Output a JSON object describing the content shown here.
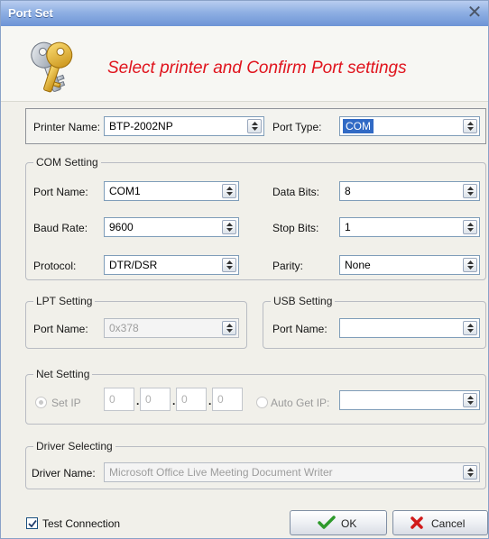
{
  "window": {
    "title": "Port Set"
  },
  "header": {
    "message": "Select printer and Confirm Port settings"
  },
  "printer": {
    "name_label": "Printer Name:",
    "name_value": "BTP-2002NP",
    "port_type_label": "Port Type:",
    "port_type_value": "COM"
  },
  "com": {
    "legend": "COM Setting",
    "port_name_label": "Port Name:",
    "port_name_value": "COM1",
    "baud_rate_label": "Baud Rate:",
    "baud_rate_value": "9600",
    "protocol_label": "Protocol:",
    "protocol_value": "DTR/DSR",
    "data_bits_label": "Data Bits:",
    "data_bits_value": "8",
    "stop_bits_label": "Stop Bits:",
    "stop_bits_value": "1",
    "parity_label": "Parity:",
    "parity_value": "None"
  },
  "lpt": {
    "legend": "LPT Setting",
    "port_name_label": "Port Name:",
    "port_name_value": "0x378"
  },
  "usb": {
    "legend": "USB Setting",
    "port_name_label": "Port Name:",
    "port_name_value": ""
  },
  "net": {
    "legend": "Net Setting",
    "set_ip_label": "Set IP",
    "ip_octets": [
      "0",
      "0",
      "0",
      "0"
    ],
    "auto_ip_label": "Auto Get IP:",
    "auto_ip_value": ""
  },
  "driver": {
    "legend": "Driver Selecting",
    "name_label": "Driver Name:",
    "name_value": "Microsoft Office Live Meeting Document Writer"
  },
  "footer": {
    "test_connection_label": "Test Connection",
    "test_connection_checked": true,
    "ok_label": "OK",
    "cancel_label": "Cancel"
  },
  "colors": {
    "header_text": "#e0141d",
    "selection": "#316ac5",
    "ok_check": "#2e9a2b",
    "cancel_x": "#d11a1a"
  }
}
